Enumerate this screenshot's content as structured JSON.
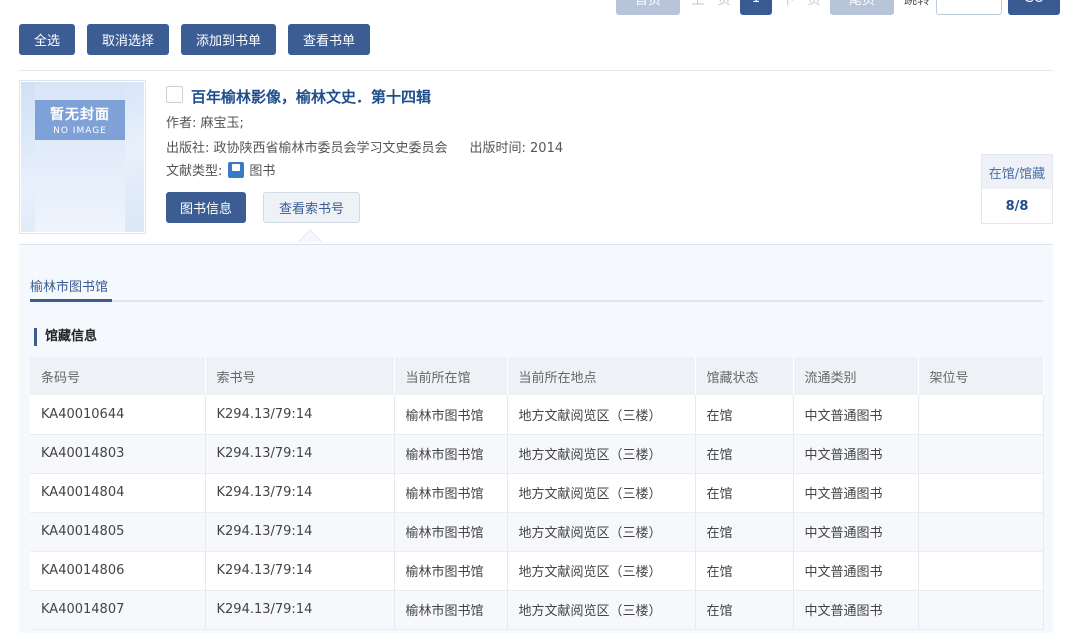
{
  "pager": {
    "first": "首页",
    "prev": "上一页",
    "current": "1",
    "next": "下一页",
    "last": "尾页",
    "jump_label": "跳转",
    "jump_value": "",
    "go": "GO"
  },
  "toolbar": {
    "select_all": "全选",
    "cancel_select": "取消选择",
    "add_to_list": "添加到书单",
    "view_list": "查看书单"
  },
  "book": {
    "cover_cn": "暂无封面",
    "cover_en": "NO IMAGE",
    "title": "百年榆林影像，榆林文史．第十四辑",
    "author": "作者: 麻宝玉;",
    "publisher": "出版社: 政协陕西省榆林市委员会学习文史委员会",
    "pub_time": "出版时间: 2014",
    "doc_type_label": "文献类型:",
    "doc_type_value": "图书",
    "btn_info": "图书信息",
    "btn_callno": "查看索书号",
    "holdings_label": "在馆/馆藏",
    "holdings_value": "8/8"
  },
  "detail": {
    "library_tab": "榆林市图书馆",
    "section_title": "馆藏信息",
    "columns": [
      "条码号",
      "索书号",
      "当前所在馆",
      "当前所在地点",
      "馆藏状态",
      "流通类别",
      "架位号"
    ],
    "rows": [
      [
        "KA40010644",
        "K294.13/79:14",
        "榆林市图书馆",
        "地方文献阅览区（三楼）",
        "在馆",
        "中文普通图书",
        ""
      ],
      [
        "KA40014803",
        "K294.13/79:14",
        "榆林市图书馆",
        "地方文献阅览区（三楼）",
        "在馆",
        "中文普通图书",
        ""
      ],
      [
        "KA40014804",
        "K294.13/79:14",
        "榆林市图书馆",
        "地方文献阅览区（三楼）",
        "在馆",
        "中文普通图书",
        ""
      ],
      [
        "KA40014805",
        "K294.13/79:14",
        "榆林市图书馆",
        "地方文献阅览区（三楼）",
        "在馆",
        "中文普通图书",
        ""
      ],
      [
        "KA40014806",
        "K294.13/79:14",
        "榆林市图书馆",
        "地方文献阅览区（三楼）",
        "在馆",
        "中文普通图书",
        ""
      ],
      [
        "KA40014807",
        "K294.13/79:14",
        "榆林市图书馆",
        "地方文献阅览区（三楼）",
        "在馆",
        "中文普通图书",
        ""
      ]
    ]
  }
}
